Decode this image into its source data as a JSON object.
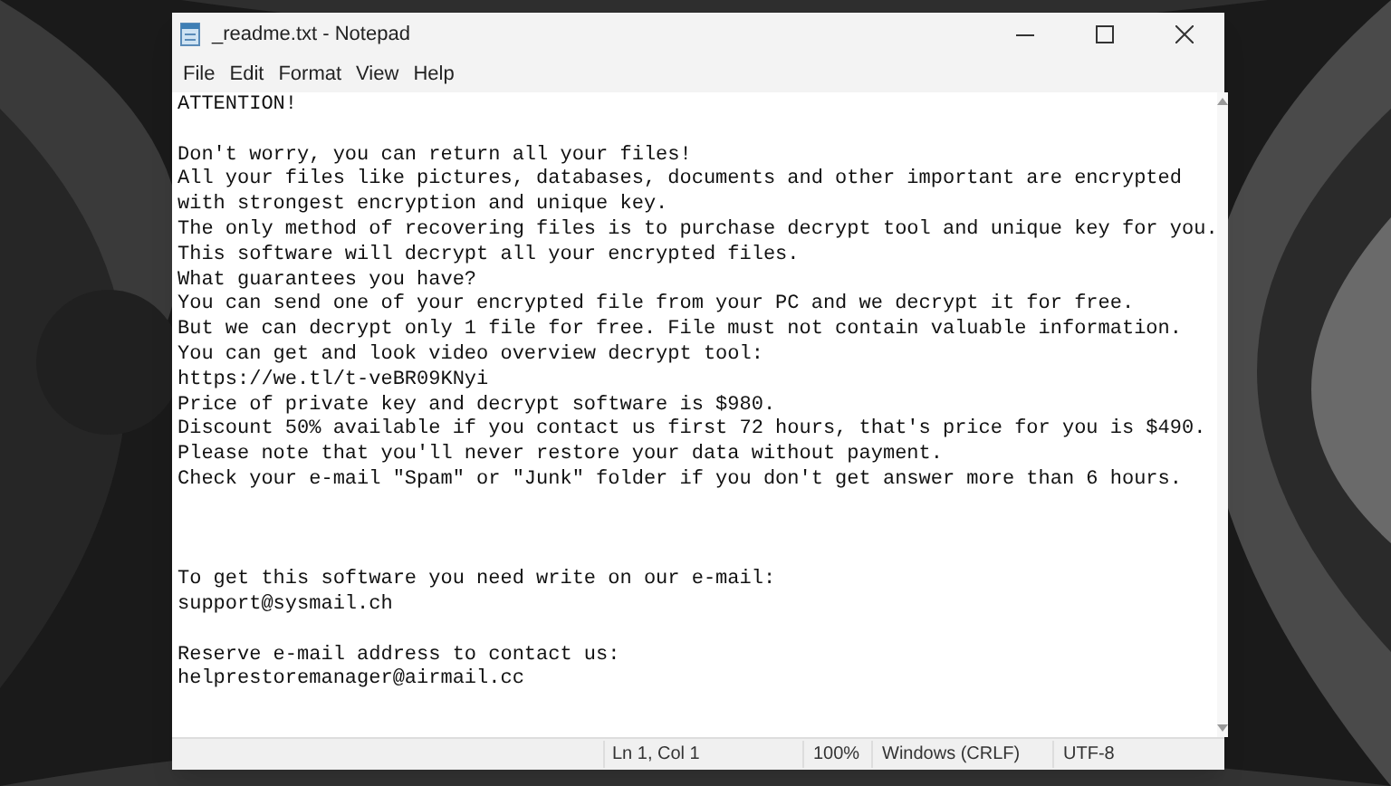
{
  "window": {
    "title": "_readme.txt - Notepad"
  },
  "menu": [
    "File",
    "Edit",
    "Format",
    "View",
    "Help"
  ],
  "document": {
    "blocks": [
      {
        "kind": "first",
        "lines": [
          "ATTENTION!"
        ]
      },
      {
        "kind": "paragraph",
        "lines": [
          "Don't worry, you can return all your files!",
          "All your files like pictures, databases, documents and other important are encrypted",
          "with strongest encryption and unique key.",
          "The only method of recovering files is to purchase decrypt tool and unique key for you.",
          "This software will decrypt all your encrypted files.",
          "What guarantees you have?",
          "You can send one of your encrypted file from your PC and we decrypt it for free.",
          "But we can decrypt only 1 file for free. File must not contain valuable information.",
          "You can get and look video overview decrypt tool:",
          "https://we.tl/t-veBR09KNyi",
          "Price of private key and decrypt software is $980.",
          "Discount 50% available if you contact us first 72 hours, that's price for you is $490.",
          "Please note that you'll never restore your data without payment.",
          "Check your e-mail \"Spam\" or \"Junk\" folder if you don't get answer more than 6 hours."
        ]
      },
      {
        "kind": "section",
        "lines": [
          "To get this software you need write on our e-mail:",
          "support@sysmail.ch"
        ]
      },
      {
        "kind": "paragraph",
        "lines": [
          "Reserve e-mail address to contact us:",
          "helprestoremanager@airmail.cc"
        ]
      }
    ]
  },
  "status_bar": {
    "position": "Ln 1, Col 1",
    "zoom": "100%",
    "line_ending": "Windows (CRLF)",
    "encoding": "UTF-8"
  }
}
